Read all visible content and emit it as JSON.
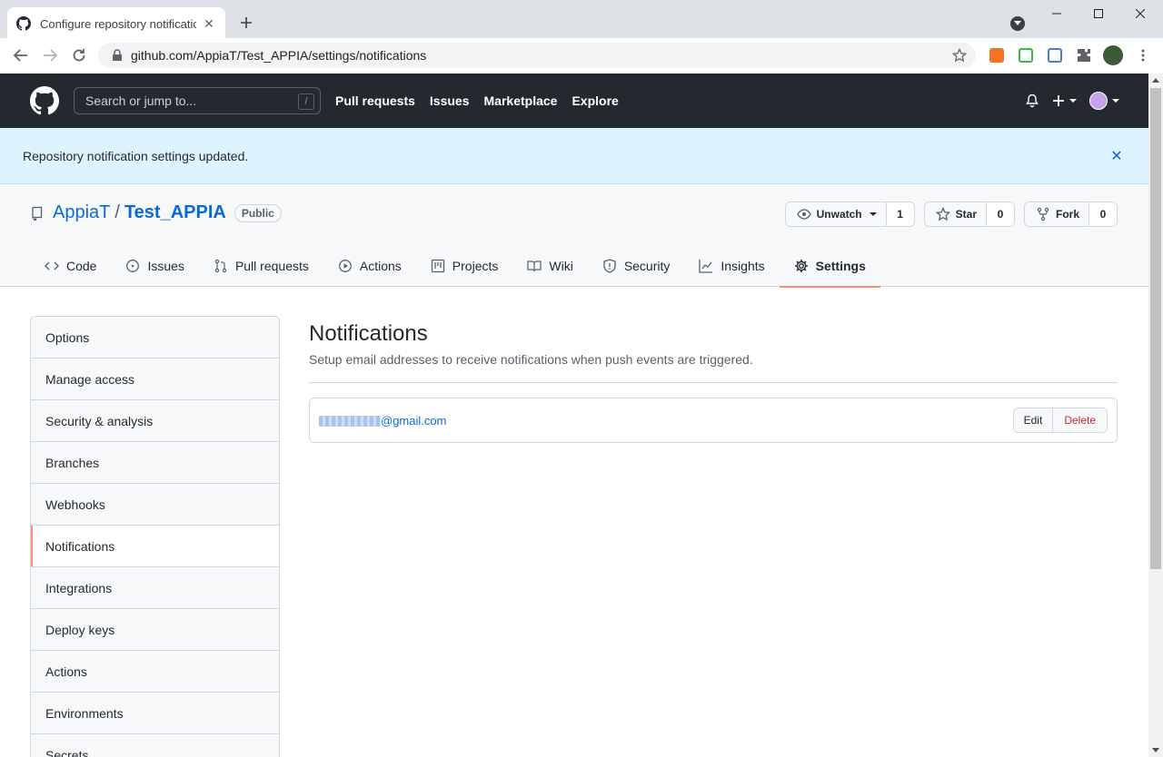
{
  "browser": {
    "tab_title": "Configure repository notifications",
    "url": "github.com/AppiaT/Test_APPIA/settings/notifications",
    "new_tab": "+",
    "window_minimize": "—",
    "window_maximize": "☐",
    "window_close": "✕"
  },
  "header": {
    "search_placeholder": "Search or jump to...",
    "search_shortcut": "/",
    "nav": [
      "Pull requests",
      "Issues",
      "Marketplace",
      "Explore"
    ]
  },
  "flash": {
    "message": "Repository notification settings updated.",
    "close": "✕"
  },
  "repo": {
    "owner": "AppiaT",
    "separator": "/",
    "name": "Test_APPIA",
    "visibility": "Public",
    "watch_label": "Unwatch",
    "watch_count": "1",
    "star_label": "Star",
    "star_count": "0",
    "fork_label": "Fork",
    "fork_count": "0",
    "tabs": [
      "Code",
      "Issues",
      "Pull requests",
      "Actions",
      "Projects",
      "Wiki",
      "Security",
      "Insights",
      "Settings"
    ],
    "selected_tab": "Settings"
  },
  "sidebar": {
    "items": [
      "Options",
      "Manage access",
      "Security & analysis",
      "Branches",
      "Webhooks",
      "Notifications",
      "Integrations",
      "Deploy keys",
      "Actions",
      "Environments",
      "Secrets"
    ],
    "selected": "Notifications"
  },
  "main": {
    "title": "Notifications",
    "description": "Setup email addresses to receive notifications when push events are triggered.",
    "email_domain": "@gmail.com",
    "edit_label": "Edit",
    "delete_label": "Delete"
  },
  "colors": {
    "header_bg": "#24292f",
    "flash_bg": "#ddf4ff",
    "link": "#0969da",
    "danger": "#cf222e",
    "underline_accent": "#fd8c73"
  }
}
